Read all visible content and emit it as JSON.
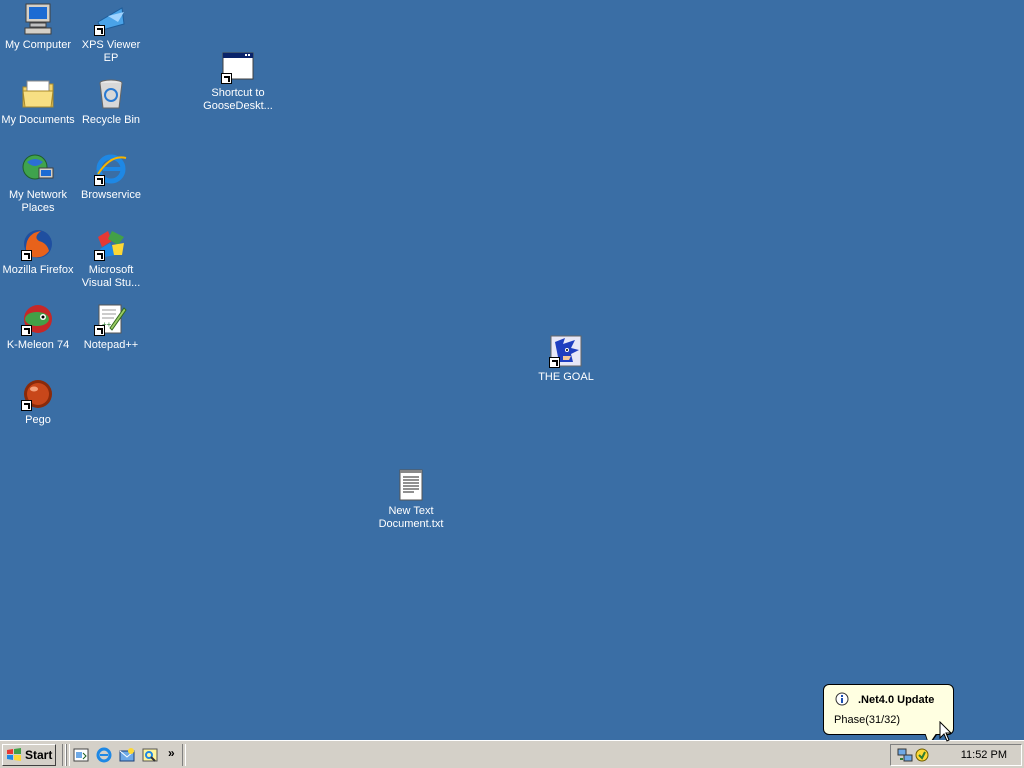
{
  "desktop_icons": [
    {
      "label": "My Computer",
      "icon": "my-computer-icon"
    },
    {
      "label": "XPS Viewer EP",
      "icon": "xps-viewer-icon"
    },
    {
      "label": "Shortcut to GooseDeskt...",
      "icon": "window-shortcut-icon"
    },
    {
      "label": "My Documents",
      "icon": "folder-icon"
    },
    {
      "label": "Recycle Bin",
      "icon": "recycle-bin-icon"
    },
    {
      "label": "My Network Places",
      "icon": "network-places-icon"
    },
    {
      "label": "Browservice",
      "icon": "internet-explorer-icon"
    },
    {
      "label": "Mozilla Firefox",
      "icon": "firefox-icon"
    },
    {
      "label": "Microsoft Visual Stu...",
      "icon": "visual-studio-icon"
    },
    {
      "label": "K-Meleon 74",
      "icon": "k-meleon-icon"
    },
    {
      "label": "Notepad++",
      "icon": "notepad-plus-plus-icon"
    },
    {
      "label": "Pego",
      "icon": "pego-icon"
    },
    {
      "label": "THE GOAL",
      "icon": "sonic-icon"
    },
    {
      "label": "New Text Document.txt",
      "icon": "text-document-icon"
    }
  ],
  "taskbar": {
    "start_label": "Start",
    "chevron": "»",
    "clock": "11:52 PM"
  },
  "balloon": {
    "title": ".Net4.0 Update",
    "text": "Phase(31/32)",
    "icon": "info-icon"
  }
}
